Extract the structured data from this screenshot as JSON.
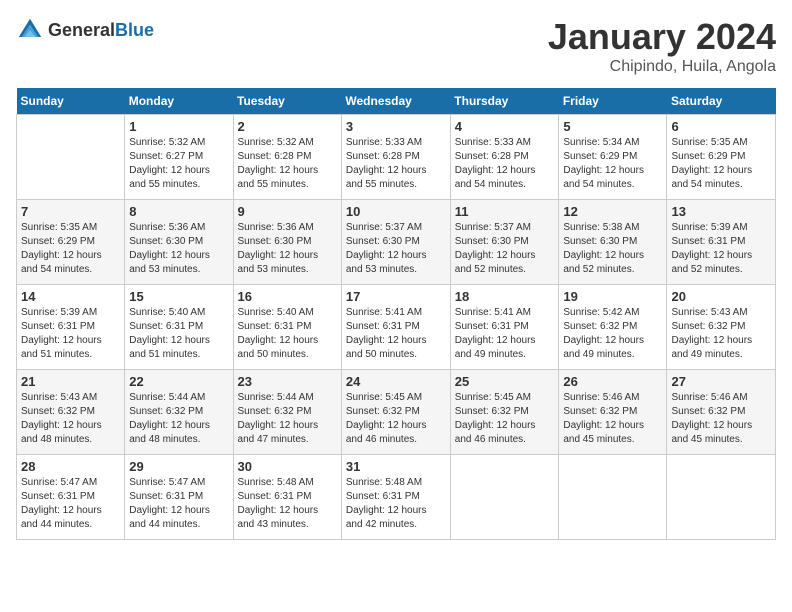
{
  "logo": {
    "general": "General",
    "blue": "Blue"
  },
  "header": {
    "month": "January 2024",
    "location": "Chipindo, Huila, Angola"
  },
  "weekdays": [
    "Sunday",
    "Monday",
    "Tuesday",
    "Wednesday",
    "Thursday",
    "Friday",
    "Saturday"
  ],
  "weeks": [
    [
      {
        "day": "",
        "info": ""
      },
      {
        "day": "1",
        "info": "Sunrise: 5:32 AM\nSunset: 6:27 PM\nDaylight: 12 hours\nand 55 minutes."
      },
      {
        "day": "2",
        "info": "Sunrise: 5:32 AM\nSunset: 6:28 PM\nDaylight: 12 hours\nand 55 minutes."
      },
      {
        "day": "3",
        "info": "Sunrise: 5:33 AM\nSunset: 6:28 PM\nDaylight: 12 hours\nand 55 minutes."
      },
      {
        "day": "4",
        "info": "Sunrise: 5:33 AM\nSunset: 6:28 PM\nDaylight: 12 hours\nand 54 minutes."
      },
      {
        "day": "5",
        "info": "Sunrise: 5:34 AM\nSunset: 6:29 PM\nDaylight: 12 hours\nand 54 minutes."
      },
      {
        "day": "6",
        "info": "Sunrise: 5:35 AM\nSunset: 6:29 PM\nDaylight: 12 hours\nand 54 minutes."
      }
    ],
    [
      {
        "day": "7",
        "info": "Sunrise: 5:35 AM\nSunset: 6:29 PM\nDaylight: 12 hours\nand 54 minutes."
      },
      {
        "day": "8",
        "info": "Sunrise: 5:36 AM\nSunset: 6:30 PM\nDaylight: 12 hours\nand 53 minutes."
      },
      {
        "day": "9",
        "info": "Sunrise: 5:36 AM\nSunset: 6:30 PM\nDaylight: 12 hours\nand 53 minutes."
      },
      {
        "day": "10",
        "info": "Sunrise: 5:37 AM\nSunset: 6:30 PM\nDaylight: 12 hours\nand 53 minutes."
      },
      {
        "day": "11",
        "info": "Sunrise: 5:37 AM\nSunset: 6:30 PM\nDaylight: 12 hours\nand 52 minutes."
      },
      {
        "day": "12",
        "info": "Sunrise: 5:38 AM\nSunset: 6:30 PM\nDaylight: 12 hours\nand 52 minutes."
      },
      {
        "day": "13",
        "info": "Sunrise: 5:39 AM\nSunset: 6:31 PM\nDaylight: 12 hours\nand 52 minutes."
      }
    ],
    [
      {
        "day": "14",
        "info": "Sunrise: 5:39 AM\nSunset: 6:31 PM\nDaylight: 12 hours\nand 51 minutes."
      },
      {
        "day": "15",
        "info": "Sunrise: 5:40 AM\nSunset: 6:31 PM\nDaylight: 12 hours\nand 51 minutes."
      },
      {
        "day": "16",
        "info": "Sunrise: 5:40 AM\nSunset: 6:31 PM\nDaylight: 12 hours\nand 50 minutes."
      },
      {
        "day": "17",
        "info": "Sunrise: 5:41 AM\nSunset: 6:31 PM\nDaylight: 12 hours\nand 50 minutes."
      },
      {
        "day": "18",
        "info": "Sunrise: 5:41 AM\nSunset: 6:31 PM\nDaylight: 12 hours\nand 49 minutes."
      },
      {
        "day": "19",
        "info": "Sunrise: 5:42 AM\nSunset: 6:32 PM\nDaylight: 12 hours\nand 49 minutes."
      },
      {
        "day": "20",
        "info": "Sunrise: 5:43 AM\nSunset: 6:32 PM\nDaylight: 12 hours\nand 49 minutes."
      }
    ],
    [
      {
        "day": "21",
        "info": "Sunrise: 5:43 AM\nSunset: 6:32 PM\nDaylight: 12 hours\nand 48 minutes."
      },
      {
        "day": "22",
        "info": "Sunrise: 5:44 AM\nSunset: 6:32 PM\nDaylight: 12 hours\nand 48 minutes."
      },
      {
        "day": "23",
        "info": "Sunrise: 5:44 AM\nSunset: 6:32 PM\nDaylight: 12 hours\nand 47 minutes."
      },
      {
        "day": "24",
        "info": "Sunrise: 5:45 AM\nSunset: 6:32 PM\nDaylight: 12 hours\nand 46 minutes."
      },
      {
        "day": "25",
        "info": "Sunrise: 5:45 AM\nSunset: 6:32 PM\nDaylight: 12 hours\nand 46 minutes."
      },
      {
        "day": "26",
        "info": "Sunrise: 5:46 AM\nSunset: 6:32 PM\nDaylight: 12 hours\nand 45 minutes."
      },
      {
        "day": "27",
        "info": "Sunrise: 5:46 AM\nSunset: 6:32 PM\nDaylight: 12 hours\nand 45 minutes."
      }
    ],
    [
      {
        "day": "28",
        "info": "Sunrise: 5:47 AM\nSunset: 6:31 PM\nDaylight: 12 hours\nand 44 minutes."
      },
      {
        "day": "29",
        "info": "Sunrise: 5:47 AM\nSunset: 6:31 PM\nDaylight: 12 hours\nand 44 minutes."
      },
      {
        "day": "30",
        "info": "Sunrise: 5:48 AM\nSunset: 6:31 PM\nDaylight: 12 hours\nand 43 minutes."
      },
      {
        "day": "31",
        "info": "Sunrise: 5:48 AM\nSunset: 6:31 PM\nDaylight: 12 hours\nand 42 minutes."
      },
      {
        "day": "",
        "info": ""
      },
      {
        "day": "",
        "info": ""
      },
      {
        "day": "",
        "info": ""
      }
    ]
  ]
}
